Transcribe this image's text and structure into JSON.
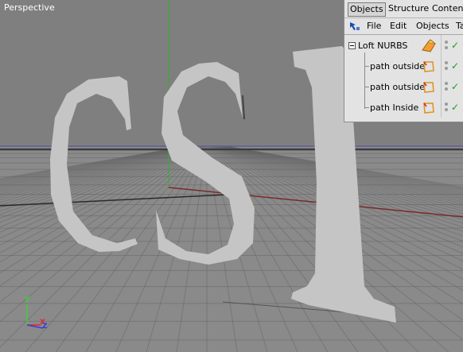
{
  "viewport": {
    "label": "Perspective",
    "axis_labels": {
      "y": "Y",
      "x": "X",
      "z": "Z"
    },
    "background_color": "#7f7f7f",
    "letters_color": "#c5c5c5",
    "grid_color": "#5a5a5a",
    "y_axis_color": "#2fb02f",
    "x_axis_color": "#7a2a2a",
    "horizon_color": "#4a4aa0"
  },
  "object_manager": {
    "tabs": [
      {
        "label": "Objects",
        "active": true
      },
      {
        "label": "Structure",
        "active": false
      },
      {
        "label": "Content",
        "active": false
      }
    ],
    "menu": {
      "icon": "pointer-icon",
      "file": "File",
      "edit": "Edit",
      "objects": "Objects",
      "more": "Ta"
    },
    "objects": [
      {
        "name": "Loft NURBS",
        "icon": "loft-nurbs-icon",
        "level": 0,
        "enabled": true
      },
      {
        "name": "path outside",
        "icon": "spline-icon",
        "level": 1,
        "enabled": true
      },
      {
        "name": "path outside",
        "icon": "spline-icon",
        "level": 1,
        "enabled": true
      },
      {
        "name": "path Inside",
        "icon": "spline-icon",
        "level": 1,
        "enabled": true
      }
    ]
  }
}
